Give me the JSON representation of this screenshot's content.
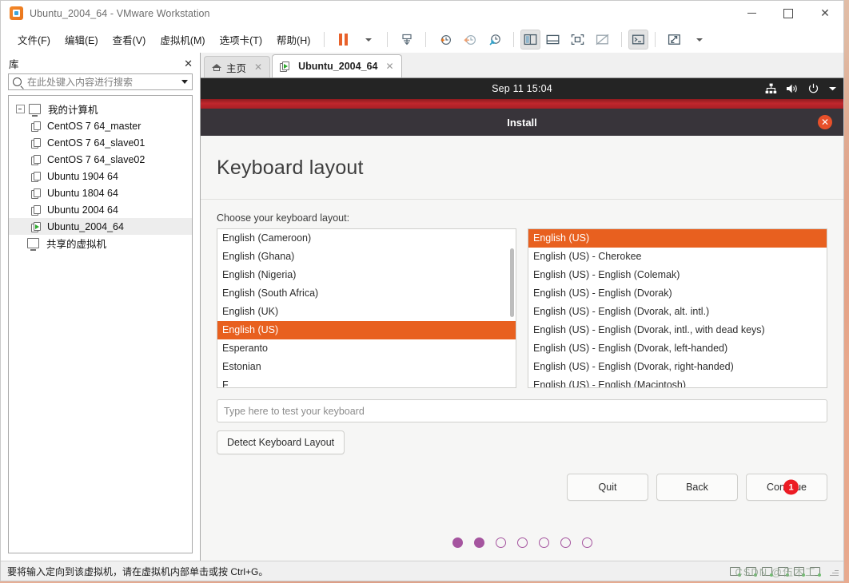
{
  "window": {
    "title": "Ubuntu_2004_64 - VMware Workstation",
    "logo_icon": "vmware-logo-icon",
    "minimize_label": "—",
    "maximize_label": "□",
    "close_label": "✕"
  },
  "menubar": {
    "items": [
      {
        "label": "文件(F)",
        "name": "menu-file"
      },
      {
        "label": "编辑(E)",
        "name": "menu-edit"
      },
      {
        "label": "查看(V)",
        "name": "menu-view"
      },
      {
        "label": "虚拟机(M)",
        "name": "menu-vm"
      },
      {
        "label": "选项卡(T)",
        "name": "menu-tabs"
      },
      {
        "label": "帮助(H)",
        "name": "menu-help"
      }
    ]
  },
  "toolbar": {
    "buttons": [
      {
        "name": "pause-button",
        "icon": "pause-icon"
      },
      {
        "name": "power-dropdown",
        "icon": "chevron-down-icon"
      },
      {
        "name": "manage-snapshot-button",
        "icon": "snapshot-manage-icon"
      },
      {
        "name": "take-snapshot-button",
        "icon": "snapshot-add-icon"
      },
      {
        "name": "revert-snapshot-button",
        "icon": "snapshot-revert-icon"
      },
      {
        "name": "snapshot-manager-button",
        "icon": "snapshot-settings-icon"
      },
      {
        "name": "show-library-button",
        "icon": "sidebar-panel-icon"
      },
      {
        "name": "show-thumbnail-bar-button",
        "icon": "bottom-panel-icon"
      },
      {
        "name": "fullscreen-button",
        "icon": "fullscreen-icon"
      },
      {
        "name": "unity-mode-button",
        "icon": "unity-mode-icon"
      },
      {
        "name": "console-button",
        "icon": "terminal-icon"
      },
      {
        "name": "stretch-button",
        "icon": "stretch-arrows-icon"
      },
      {
        "name": "stretch-dropdown",
        "icon": "chevron-down-icon"
      }
    ]
  },
  "library": {
    "title": "库",
    "close_label": "✕",
    "search": {
      "placeholder": "在此处键入内容进行搜索",
      "value": "",
      "icon": "search-icon",
      "dropdown_icon": "chevron-down-icon"
    },
    "tree": [
      {
        "label": "我的计算机",
        "icon": "computer-icon",
        "level": 0,
        "expander": true,
        "selected": false
      },
      {
        "label": "CentOS 7 64_master",
        "icon": "vm-icon",
        "level": 1,
        "selected": false
      },
      {
        "label": "CentOS 7 64_slave01",
        "icon": "vm-icon",
        "level": 1,
        "selected": false
      },
      {
        "label": "CentOS 7 64_slave02",
        "icon": "vm-icon",
        "level": 1,
        "selected": false
      },
      {
        "label": "Ubuntu 1904 64",
        "icon": "vm-icon",
        "level": 1,
        "selected": false
      },
      {
        "label": "Ubuntu 1804 64",
        "icon": "vm-icon",
        "level": 1,
        "selected": false
      },
      {
        "label": "Ubuntu 2004 64",
        "icon": "vm-icon",
        "level": 1,
        "selected": false
      },
      {
        "label": "Ubuntu_2004_64",
        "icon": "vm-running-icon",
        "level": 1,
        "selected": true
      },
      {
        "label": "共享的虚拟机",
        "icon": "shared-vm-icon",
        "level": 0,
        "selected": false
      }
    ]
  },
  "tabs": [
    {
      "label": "主页",
      "icon": "home-icon",
      "active": false,
      "close_label": "✕"
    },
    {
      "label": "Ubuntu_2004_64",
      "icon": "vm-running-icon",
      "active": true,
      "close_label": "✕"
    }
  ],
  "guest": {
    "topbar": {
      "clock": "Sep 11  15:04",
      "tray": [
        {
          "name": "network-icon"
        },
        {
          "name": "volume-icon"
        },
        {
          "name": "power-icon"
        },
        {
          "name": "chevron-down-icon"
        }
      ]
    },
    "installer": {
      "window_title": "Install",
      "close_label": "✕",
      "heading": "Keyboard layout",
      "choose_label": "Choose your keyboard layout:",
      "layouts": [
        {
          "label": "English (Cameroon)",
          "selected": false
        },
        {
          "label": "English (Ghana)",
          "selected": false
        },
        {
          "label": "English (Nigeria)",
          "selected": false
        },
        {
          "label": "English (South Africa)",
          "selected": false
        },
        {
          "label": "English (UK)",
          "selected": false
        },
        {
          "label": "English (US)",
          "selected": true
        },
        {
          "label": "Esperanto",
          "selected": false
        },
        {
          "label": "Estonian",
          "selected": false
        },
        {
          "label": "F",
          "selected": false
        }
      ],
      "variants": [
        {
          "label": "English (US)",
          "selected": true
        },
        {
          "label": "English (US) - Cherokee",
          "selected": false
        },
        {
          "label": "English (US) - English (Colemak)",
          "selected": false
        },
        {
          "label": "English (US) - English (Dvorak)",
          "selected": false
        },
        {
          "label": "English (US) - English (Dvorak, alt. intl.)",
          "selected": false
        },
        {
          "label": "English (US) - English (Dvorak, intl., with dead keys)",
          "selected": false
        },
        {
          "label": "English (US) - English (Dvorak, left-handed)",
          "selected": false
        },
        {
          "label": "English (US) - English (Dvorak, right-handed)",
          "selected": false
        },
        {
          "label": "English (US) - English (Macintosh)",
          "selected": false
        }
      ],
      "test_input": {
        "placeholder": "Type here to test your keyboard",
        "value": ""
      },
      "detect_button": "Detect Keyboard Layout",
      "quit_button": "Quit",
      "back_button": "Back",
      "continue_button": "Continue",
      "continue_badge": "1",
      "progress_dots": [
        true,
        true,
        false,
        false,
        false,
        false,
        false
      ]
    }
  },
  "statusbar": {
    "hint": "要将输入定向到该虚拟机，请在虚拟机内部单击或按 Ctrl+G。",
    "watermark": "CSDN @伍木工"
  },
  "colors": {
    "accent_orange": "#e8601f",
    "ubuntu_dark": "#38343a",
    "topbar_dark": "#242424",
    "red_band": "#c0272d",
    "progress_purple": "#a5559f",
    "badge_red": "#ec1c24",
    "vmware_orange": "#e8731a"
  }
}
